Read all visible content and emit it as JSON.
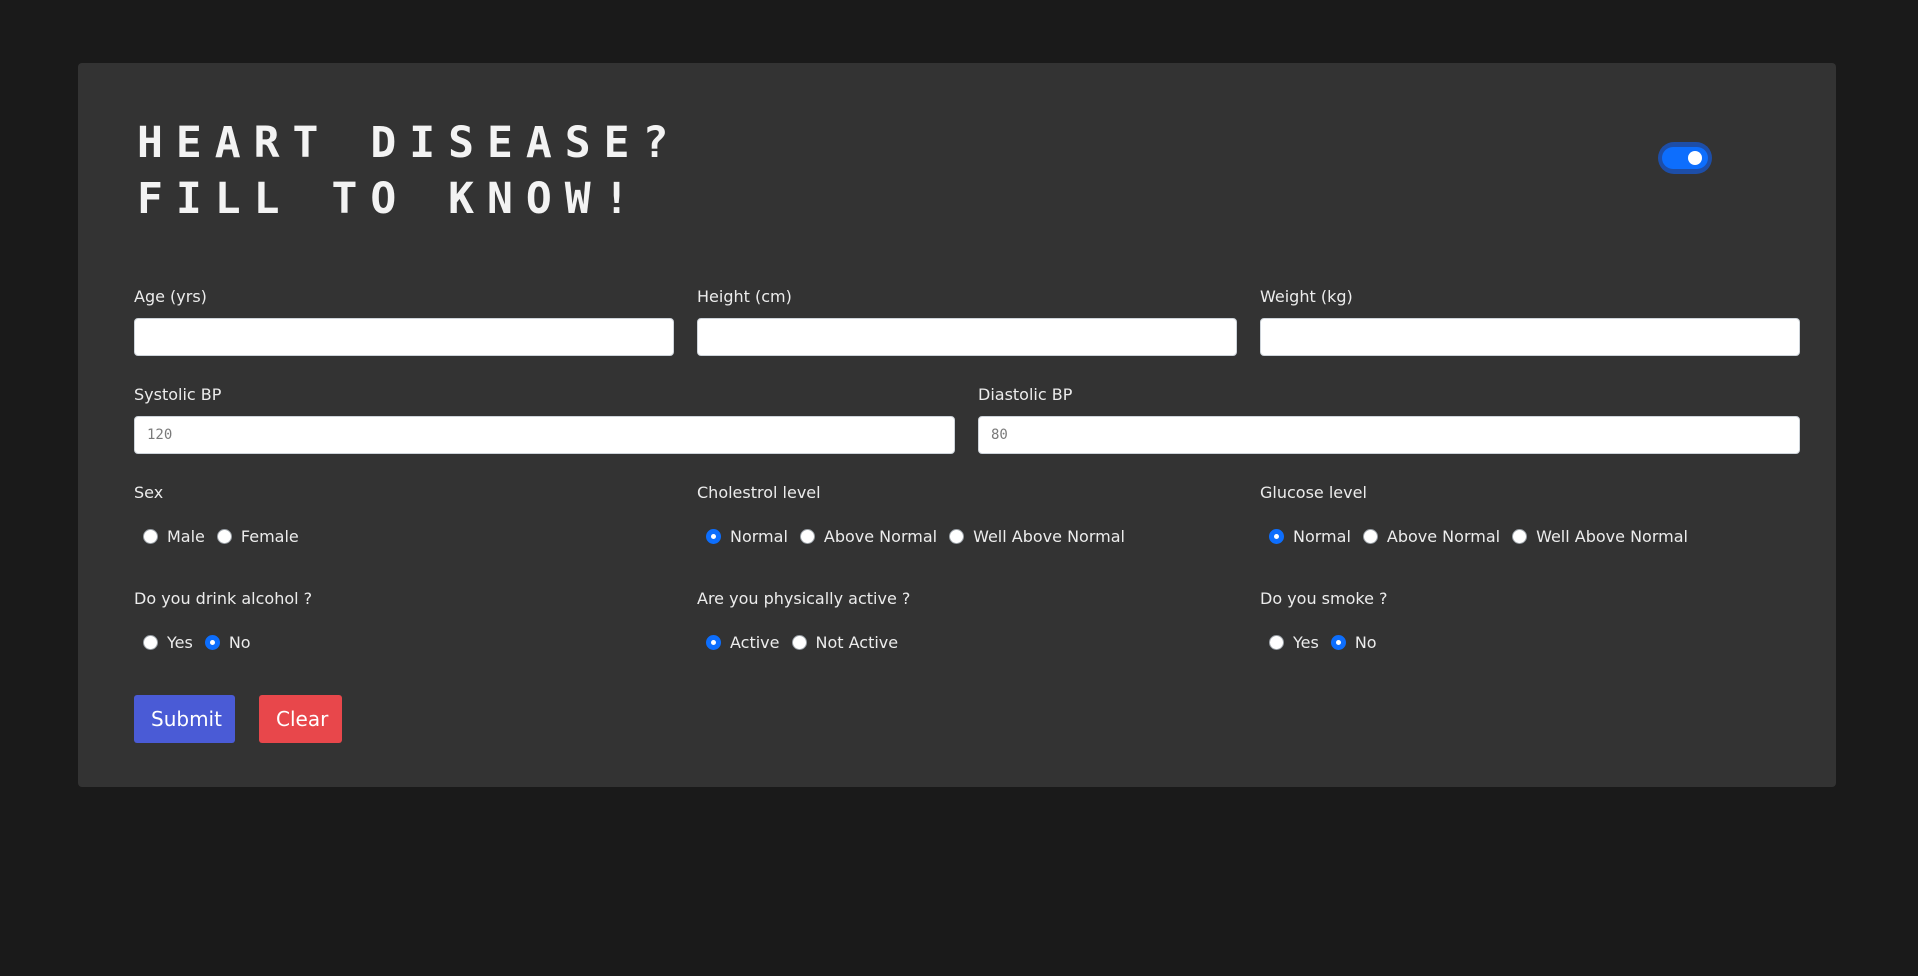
{
  "title": {
    "line1": "HEART DISEASE?",
    "line2": "FILL TO KNOW!"
  },
  "theme_toggle": {
    "state": "on",
    "accent": "#0d6efd"
  },
  "fields": {
    "age": {
      "label": "Age (yrs)",
      "value": "",
      "placeholder": ""
    },
    "height": {
      "label": "Height (cm)",
      "value": "",
      "placeholder": ""
    },
    "weight": {
      "label": "Weight (kg)",
      "value": "",
      "placeholder": ""
    },
    "systolic": {
      "label": "Systolic BP",
      "value": "",
      "placeholder": "120"
    },
    "diastolic": {
      "label": "Diastolic BP",
      "value": "",
      "placeholder": "80"
    }
  },
  "radios": {
    "sex": {
      "label": "Sex",
      "options": [
        "Male",
        "Female"
      ],
      "selected": null
    },
    "cholesterol": {
      "label": "Cholestrol level",
      "options": [
        "Normal",
        "Above Normal",
        "Well Above Normal"
      ],
      "selected": "Normal"
    },
    "glucose": {
      "label": "Glucose level",
      "options": [
        "Normal",
        "Above Normal",
        "Well Above Normal"
      ],
      "selected": "Normal"
    },
    "alcohol": {
      "label": "Do you drink alcohol ?",
      "options": [
        "Yes",
        "No"
      ],
      "selected": "No"
    },
    "active": {
      "label": "Are you physically active ?",
      "options": [
        "Active",
        "Not Active"
      ],
      "selected": "Active"
    },
    "smoke": {
      "label": "Do you smoke ?",
      "options": [
        "Yes",
        "No"
      ],
      "selected": "No"
    }
  },
  "buttons": {
    "submit": "Submit",
    "clear": "Clear"
  },
  "colors": {
    "page_bg": "#1a1a1a",
    "card_bg": "#333333",
    "submit_bg": "#4a5bd6",
    "clear_bg": "#e8474b",
    "radio_checked": "#0d6efd"
  }
}
